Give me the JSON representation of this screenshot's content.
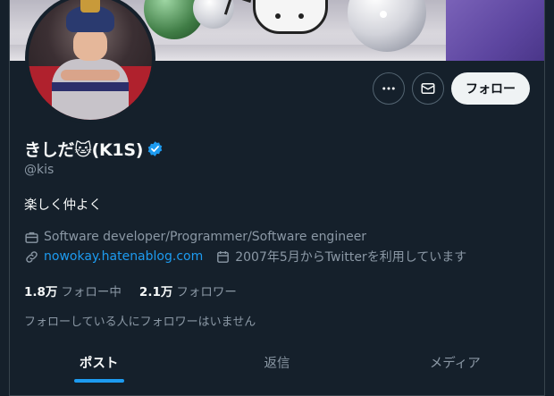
{
  "profile": {
    "display_name": "きしだ🐱(K1S)",
    "handle": "@kis",
    "bio": "楽しく仲よく",
    "occupation": "Software developer/Programmer/Software engineer",
    "website": "nowokay.hatenablog.com",
    "joined": "2007年5月からTwitterを利用しています",
    "following_count": "1.8万",
    "following_label": "フォロー中",
    "followers_count": "2.1万",
    "followers_label": "フォロワー",
    "followed_by_note": "フォローしている人にフォロワーはいません"
  },
  "actions": {
    "more_icon": "ellipsis-icon",
    "message_icon": "envelope-icon",
    "follow_label": "フォロー"
  },
  "tabs": [
    {
      "label": "ポスト",
      "active": true
    },
    {
      "label": "返信",
      "active": false
    },
    {
      "label": "メディア",
      "active": false
    }
  ],
  "colors": {
    "background": "#15202b",
    "accent": "#1d9bf0",
    "secondary_text": "#8b98a5",
    "primary_text": "#f7f9f9",
    "follow_button_bg": "#eff3f4"
  }
}
